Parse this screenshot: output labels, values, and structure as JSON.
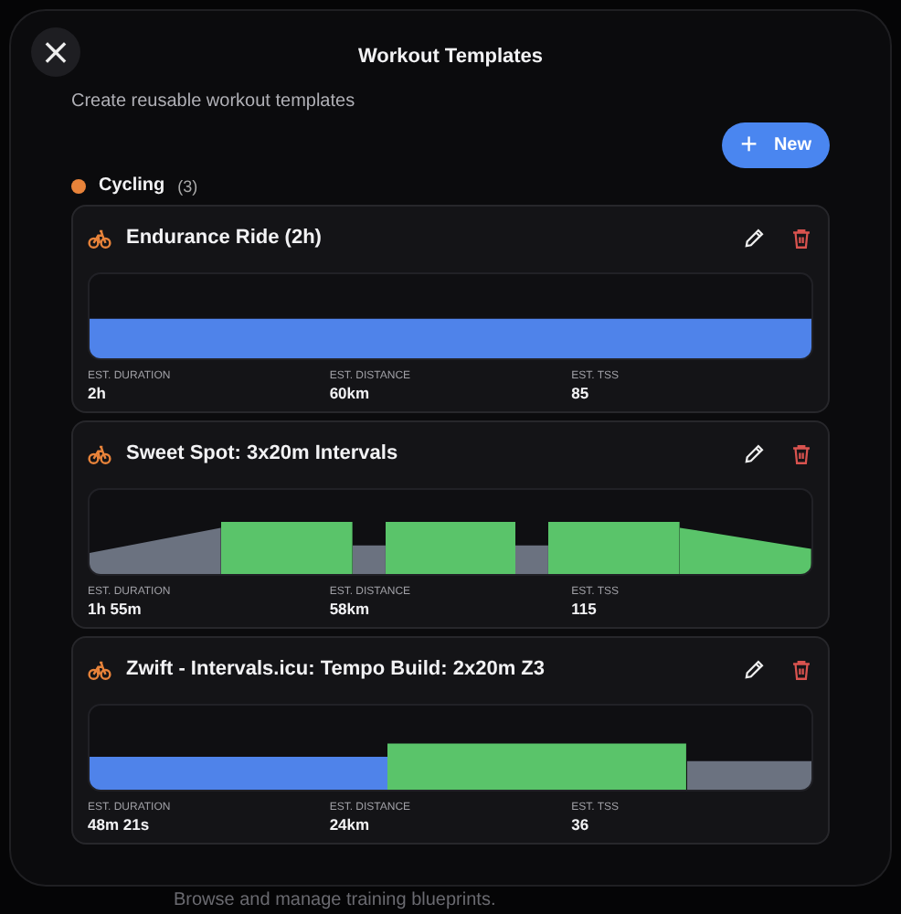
{
  "backdrop": {
    "description": "Browse and manage training blueprints."
  },
  "dialog": {
    "close": "×",
    "title": "Workout Templates",
    "subtitle": "Create reusable workout templates",
    "new_button": {
      "icon": "+",
      "label": "New"
    }
  },
  "category": {
    "name": "Cycling",
    "count": "(3)",
    "color": "#e8833a"
  },
  "templates": [
    {
      "name": "Endurance Ride (2h)",
      "segments": [
        {
          "kind": "endurance",
          "color": "#4f83ea"
        }
      ],
      "stats": [
        {
          "label": "EST. DURATION",
          "value": "2h"
        },
        {
          "label": "EST. DISTANCE",
          "value": "60km"
        },
        {
          "label": "EST. TSS",
          "value": "85"
        }
      ]
    },
    {
      "name": "Sweet Spot: 3x20m Intervals",
      "segments": [
        {
          "kind": "warmup",
          "color": "#6b7280"
        },
        {
          "kind": "interval",
          "color": "#5ac46a"
        },
        {
          "kind": "rest",
          "color": "#6b7280"
        },
        {
          "kind": "interval",
          "color": "#5ac46a"
        },
        {
          "kind": "rest",
          "color": "#6b7280"
        },
        {
          "kind": "interval",
          "color": "#5ac46a"
        },
        {
          "kind": "cooldown",
          "color": "#5ac46a"
        }
      ],
      "stats": [
        {
          "label": "EST. DURATION",
          "value": "1h 55m"
        },
        {
          "label": "EST. DISTANCE",
          "value": "58km"
        },
        {
          "label": "EST. TSS",
          "value": "115"
        }
      ]
    },
    {
      "name": "Zwift - Intervals.icu: Tempo Build: 2x20m Z3",
      "segments": [
        {
          "kind": "base",
          "color": "#4f83ea"
        },
        {
          "kind": "tempo",
          "color": "#5ac46a"
        },
        {
          "kind": "easy",
          "color": "#6b7280"
        }
      ],
      "stats": [
        {
          "label": "EST. DURATION",
          "value": "48m 21s"
        },
        {
          "label": "EST. DISTANCE",
          "value": "24km"
        },
        {
          "label": "EST. TSS",
          "value": "36"
        }
      ]
    }
  ]
}
